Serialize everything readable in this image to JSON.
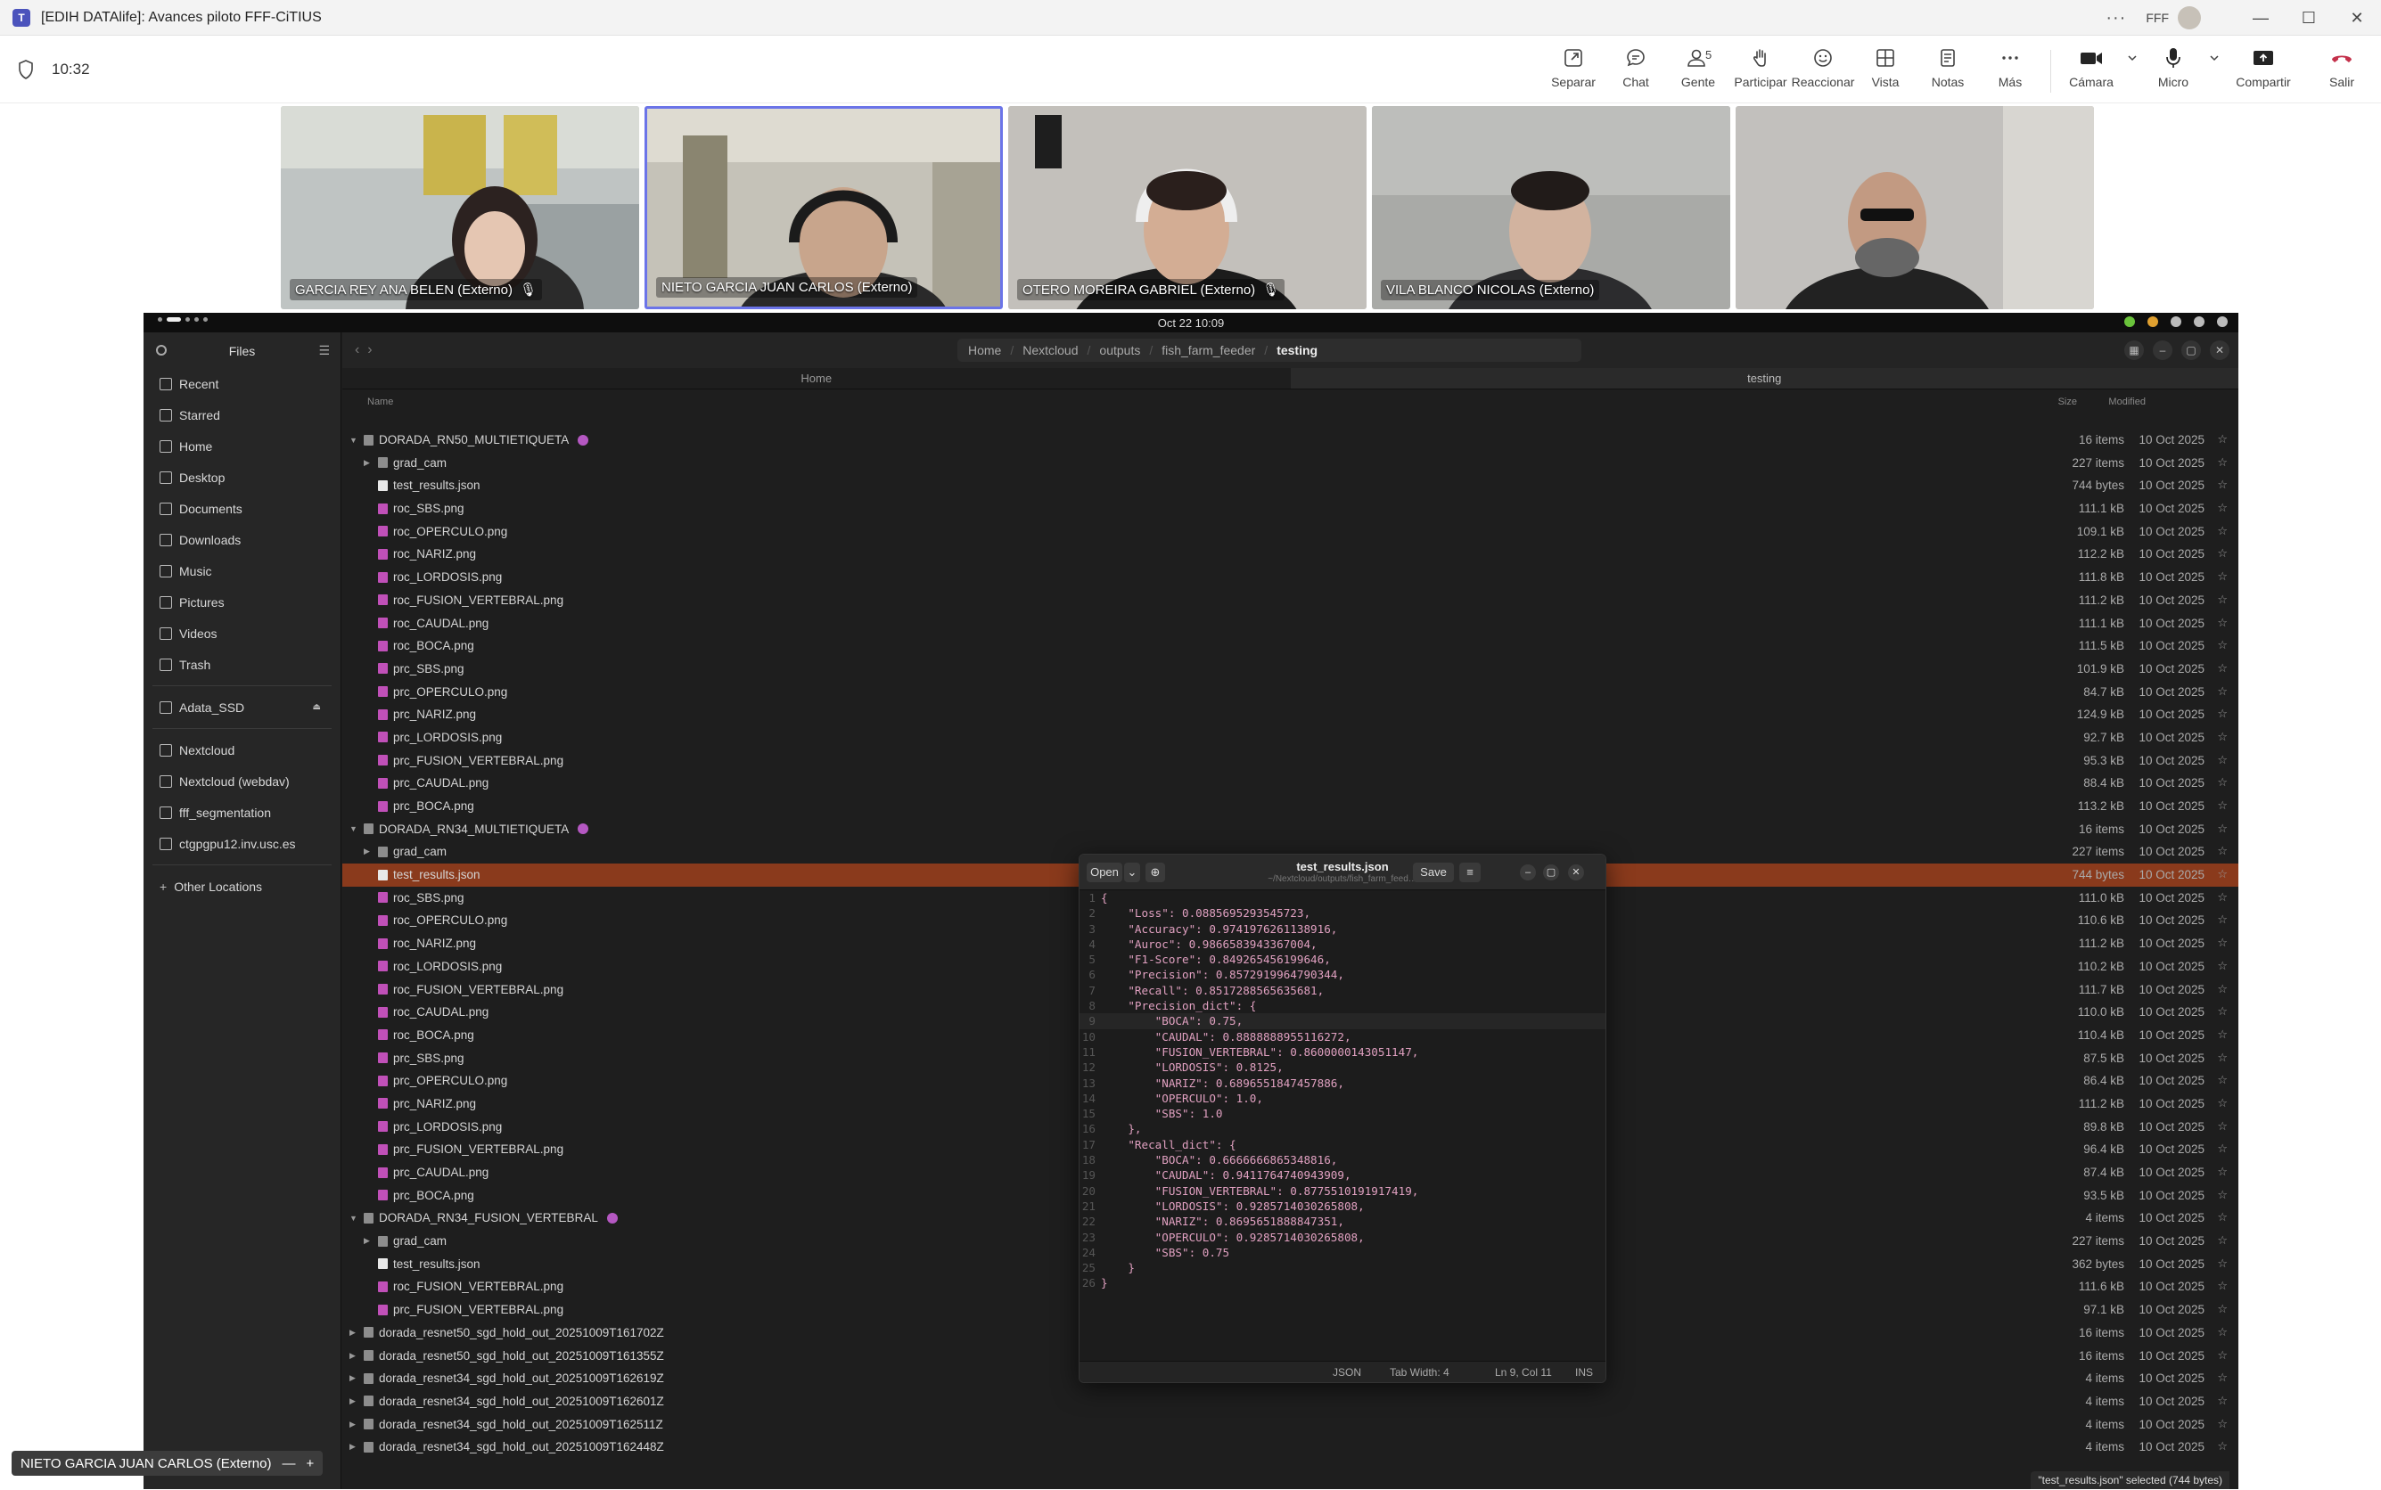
{
  "app": {
    "title": "[EDIH DATAlife]: Avances piloto FFF-CiTIUS",
    "user_initials": "FFF",
    "window_controls": [
      "minimize-icon",
      "maximize-icon",
      "close-icon"
    ]
  },
  "meeting": {
    "timer": "10:32",
    "people_count": "5",
    "tools": [
      {
        "name": "separar",
        "label": "Separar",
        "icon": "popout-icon"
      },
      {
        "name": "chat",
        "label": "Chat",
        "icon": "chat-icon"
      },
      {
        "name": "gente",
        "label": "Gente",
        "icon": "people-icon"
      },
      {
        "name": "participar",
        "label": "Participar",
        "icon": "raise-hand-icon"
      },
      {
        "name": "reaccionar",
        "label": "Reaccionar",
        "icon": "emoji-icon"
      },
      {
        "name": "vista",
        "label": "Vista",
        "icon": "grid-view-icon"
      },
      {
        "name": "notas",
        "label": "Notas",
        "icon": "notes-icon"
      },
      {
        "name": "mas",
        "label": "Más",
        "icon": "more-icon"
      }
    ],
    "device_tools": [
      {
        "name": "camara",
        "label": "Cámara",
        "icon": "camera-icon"
      },
      {
        "name": "micro",
        "label": "Micro",
        "icon": "microphone-icon"
      },
      {
        "name": "compartir",
        "label": "Compartir",
        "icon": "share-screen-icon"
      },
      {
        "name": "salir",
        "label": "Salir",
        "icon": "hangup-icon"
      }
    ],
    "participants": [
      {
        "name": "GARCIA REY ANA BELEN (Externo)",
        "muted": true
      },
      {
        "name": "NIETO GARCIA JUAN CARLOS (Externo)",
        "muted": false,
        "active": true
      },
      {
        "name": "OTERO MOREIRA GABRIEL (Externo)",
        "muted": true
      },
      {
        "name": "VILA BLANCO NICOLAS (Externo)",
        "muted": false
      },
      {
        "name": "",
        "muted": false
      }
    ],
    "presenter_label": "NIETO GARCIA JUAN CARLOS (Externo)",
    "colors": {
      "accent": "#6b74e8",
      "hangup": "#c4314b"
    }
  },
  "desktop": {
    "clock": "Oct 22  10:09"
  },
  "files": {
    "sidebar_title": "Files",
    "places": [
      "Recent",
      "Starred",
      "Home",
      "Desktop",
      "Documents",
      "Downloads",
      "Music",
      "Pictures",
      "Videos",
      "Trash"
    ],
    "devices": [
      "Adata_SSD"
    ],
    "network": [
      "Nextcloud",
      "Nextcloud (webdav)",
      "fff_segmentation",
      "ctgpgpu12.inv.usc.es"
    ],
    "other_locations": "Other Locations",
    "path": [
      "Home",
      "Nextcloud",
      "outputs",
      "fish_farm_feeder",
      "testing"
    ],
    "tabs": [
      "Home",
      "testing"
    ],
    "columns": {
      "name": "Name",
      "size": "Size",
      "modified": "Modified"
    },
    "rows": [
      {
        "name": "DORADA_RN50_MULTIETIQUETA",
        "type": "dir",
        "level": 0,
        "expanded": true,
        "badge": true,
        "size": "16 items",
        "modified": "10 Oct 2025"
      },
      {
        "name": "grad_cam",
        "type": "dir",
        "level": 1,
        "expanded": false,
        "size": "227 items",
        "modified": "10 Oct 2025"
      },
      {
        "name": "test_results.json",
        "type": "json",
        "level": 1,
        "size": "744 bytes",
        "modified": "10 Oct 2025"
      },
      {
        "name": "roc_SBS.png",
        "type": "png",
        "level": 1,
        "size": "111.1 kB",
        "modified": "10 Oct 2025"
      },
      {
        "name": "roc_OPERCULO.png",
        "type": "png",
        "level": 1,
        "size": "109.1 kB",
        "modified": "10 Oct 2025"
      },
      {
        "name": "roc_NARIZ.png",
        "type": "png",
        "level": 1,
        "size": "112.2 kB",
        "modified": "10 Oct 2025"
      },
      {
        "name": "roc_LORDOSIS.png",
        "type": "png",
        "level": 1,
        "size": "111.8 kB",
        "modified": "10 Oct 2025"
      },
      {
        "name": "roc_FUSION_VERTEBRAL.png",
        "type": "png",
        "level": 1,
        "size": "111.2 kB",
        "modified": "10 Oct 2025"
      },
      {
        "name": "roc_CAUDAL.png",
        "type": "png",
        "level": 1,
        "size": "111.1 kB",
        "modified": "10 Oct 2025"
      },
      {
        "name": "roc_BOCA.png",
        "type": "png",
        "level": 1,
        "size": "111.5 kB",
        "modified": "10 Oct 2025"
      },
      {
        "name": "prc_SBS.png",
        "type": "png",
        "level": 1,
        "size": "101.9 kB",
        "modified": "10 Oct 2025"
      },
      {
        "name": "prc_OPERCULO.png",
        "type": "png",
        "level": 1,
        "size": "84.7 kB",
        "modified": "10 Oct 2025"
      },
      {
        "name": "prc_NARIZ.png",
        "type": "png",
        "level": 1,
        "size": "124.9 kB",
        "modified": "10 Oct 2025"
      },
      {
        "name": "prc_LORDOSIS.png",
        "type": "png",
        "level": 1,
        "size": "92.7 kB",
        "modified": "10 Oct 2025"
      },
      {
        "name": "prc_FUSION_VERTEBRAL.png",
        "type": "png",
        "level": 1,
        "size": "95.3 kB",
        "modified": "10 Oct 2025"
      },
      {
        "name": "prc_CAUDAL.png",
        "type": "png",
        "level": 1,
        "size": "88.4 kB",
        "modified": "10 Oct 2025"
      },
      {
        "name": "prc_BOCA.png",
        "type": "png",
        "level": 1,
        "size": "113.2 kB",
        "modified": "10 Oct 2025"
      },
      {
        "name": "DORADA_RN34_MULTIETIQUETA",
        "type": "dir",
        "level": 0,
        "expanded": true,
        "badge": true,
        "size": "16 items",
        "modified": "10 Oct 2025"
      },
      {
        "name": "grad_cam",
        "type": "dir",
        "level": 1,
        "expanded": false,
        "size": "227 items",
        "modified": "10 Oct 2025"
      },
      {
        "name": "test_results.json",
        "type": "json",
        "level": 1,
        "selected": true,
        "size": "744 bytes",
        "modified": "10 Oct 2025"
      },
      {
        "name": "roc_SBS.png",
        "type": "png",
        "level": 1,
        "size": "111.0 kB",
        "modified": "10 Oct 2025"
      },
      {
        "name": "roc_OPERCULO.png",
        "type": "png",
        "level": 1,
        "size": "110.6 kB",
        "modified": "10 Oct 2025"
      },
      {
        "name": "roc_NARIZ.png",
        "type": "png",
        "level": 1,
        "size": "111.2 kB",
        "modified": "10 Oct 2025"
      },
      {
        "name": "roc_LORDOSIS.png",
        "type": "png",
        "level": 1,
        "size": "110.2 kB",
        "modified": "10 Oct 2025"
      },
      {
        "name": "roc_FUSION_VERTEBRAL.png",
        "type": "png",
        "level": 1,
        "size": "111.7 kB",
        "modified": "10 Oct 2025"
      },
      {
        "name": "roc_CAUDAL.png",
        "type": "png",
        "level": 1,
        "size": "110.0 kB",
        "modified": "10 Oct 2025"
      },
      {
        "name": "roc_BOCA.png",
        "type": "png",
        "level": 1,
        "size": "110.4 kB",
        "modified": "10 Oct 2025"
      },
      {
        "name": "prc_SBS.png",
        "type": "png",
        "level": 1,
        "size": "87.5 kB",
        "modified": "10 Oct 2025"
      },
      {
        "name": "prc_OPERCULO.png",
        "type": "png",
        "level": 1,
        "size": "86.4 kB",
        "modified": "10 Oct 2025"
      },
      {
        "name": "prc_NARIZ.png",
        "type": "png",
        "level": 1,
        "size": "111.2 kB",
        "modified": "10 Oct 2025"
      },
      {
        "name": "prc_LORDOSIS.png",
        "type": "png",
        "level": 1,
        "size": "89.8 kB",
        "modified": "10 Oct 2025"
      },
      {
        "name": "prc_FUSION_VERTEBRAL.png",
        "type": "png",
        "level": 1,
        "size": "96.4 kB",
        "modified": "10 Oct 2025"
      },
      {
        "name": "prc_CAUDAL.png",
        "type": "png",
        "level": 1,
        "size": "87.4 kB",
        "modified": "10 Oct 2025"
      },
      {
        "name": "prc_BOCA.png",
        "type": "png",
        "level": 1,
        "size": "93.5 kB",
        "modified": "10 Oct 2025"
      },
      {
        "name": "DORADA_RN34_FUSION_VERTEBRAL",
        "type": "dir",
        "level": 0,
        "expanded": true,
        "badge": true,
        "size": "4 items",
        "modified": "10 Oct 2025"
      },
      {
        "name": "grad_cam",
        "type": "dir",
        "level": 1,
        "expanded": false,
        "size": "227 items",
        "modified": "10 Oct 2025"
      },
      {
        "name": "test_results.json",
        "type": "json",
        "level": 1,
        "size": "362 bytes",
        "modified": "10 Oct 2025"
      },
      {
        "name": "roc_FUSION_VERTEBRAL.png",
        "type": "png",
        "level": 1,
        "size": "111.6 kB",
        "modified": "10 Oct 2025"
      },
      {
        "name": "prc_FUSION_VERTEBRAL.png",
        "type": "png",
        "level": 1,
        "size": "97.1 kB",
        "modified": "10 Oct 2025"
      },
      {
        "name": "dorada_resnet50_sgd_hold_out_20251009T161702Z",
        "type": "dir",
        "level": 0,
        "expanded": false,
        "size": "16 items",
        "modified": "10 Oct 2025"
      },
      {
        "name": "dorada_resnet50_sgd_hold_out_20251009T161355Z",
        "type": "dir",
        "level": 0,
        "expanded": false,
        "size": "16 items",
        "modified": "10 Oct 2025"
      },
      {
        "name": "dorada_resnet34_sgd_hold_out_20251009T162619Z",
        "type": "dir",
        "level": 0,
        "expanded": false,
        "size": "4 items",
        "modified": "10 Oct 2025"
      },
      {
        "name": "dorada_resnet34_sgd_hold_out_20251009T162601Z",
        "type": "dir",
        "level": 0,
        "expanded": false,
        "size": "4 items",
        "modified": "10 Oct 2025"
      },
      {
        "name": "dorada_resnet34_sgd_hold_out_20251009T162511Z",
        "type": "dir",
        "level": 0,
        "expanded": false,
        "size": "4 items",
        "modified": "10 Oct 2025"
      },
      {
        "name": "dorada_resnet34_sgd_hold_out_20251009T162448Z",
        "type": "dir",
        "level": 0,
        "expanded": false,
        "size": "4 items",
        "modified": "10 Oct 2025"
      }
    ],
    "status": "\"test_results.json\" selected (744 bytes)"
  },
  "editor": {
    "title": "test_results.json",
    "subtitle": "~/Nextcloud/outputs/fish_farm_feed…",
    "open_label": "Open",
    "save_label": "Save",
    "language": "JSON",
    "tab_width": "Tab Width: 4",
    "position": "Ln 9, Col 11",
    "mode": "INS",
    "lines": [
      {
        "n": "1",
        "text": "{"
      },
      {
        "n": "2",
        "text": "    \"Loss\": 0.0885695293545723,"
      },
      {
        "n": "3",
        "text": "    \"Accuracy\": 0.9741976261138916,"
      },
      {
        "n": "4",
        "text": "    \"Auroc\": 0.9866583943367004,"
      },
      {
        "n": "5",
        "text": "    \"F1-Score\": 0.849265456199646,"
      },
      {
        "n": "6",
        "text": "    \"Precision\": 0.8572919964790344,"
      },
      {
        "n": "7",
        "text": "    \"Recall\": 0.8517288565635681,"
      },
      {
        "n": "8",
        "text": "    \"Precision_dict\": {"
      },
      {
        "n": "9",
        "text": "        \"BOCA\": 0.75,"
      },
      {
        "n": "10",
        "text": "        \"CAUDAL\": 0.8888888955116272,"
      },
      {
        "n": "11",
        "text": "        \"FUSION_VERTEBRAL\": 0.8600000143051147,"
      },
      {
        "n": "12",
        "text": "        \"LORDOSIS\": 0.8125,"
      },
      {
        "n": "13",
        "text": "        \"NARIZ\": 0.6896551847457886,"
      },
      {
        "n": "14",
        "text": "        \"OPERCULO\": 1.0,"
      },
      {
        "n": "15",
        "text": "        \"SBS\": 1.0"
      },
      {
        "n": "16",
        "text": "    },"
      },
      {
        "n": "17",
        "text": "    \"Recall_dict\": {"
      },
      {
        "n": "18",
        "text": "        \"BOCA\": 0.6666666865348816,"
      },
      {
        "n": "19",
        "text": "        \"CAUDAL\": 0.9411764740943909,"
      },
      {
        "n": "20",
        "text": "        \"FUSION_VERTEBRAL\": 0.8775510191917419,"
      },
      {
        "n": "21",
        "text": "        \"LORDOSIS\": 0.9285714030265808,"
      },
      {
        "n": "22",
        "text": "        \"NARIZ\": 0.8695651888847351,"
      },
      {
        "n": "23",
        "text": "        \"OPERCULO\": 0.9285714030265808,"
      },
      {
        "n": "24",
        "text": "        \"SBS\": 0.75"
      },
      {
        "n": "25",
        "text": "    }"
      },
      {
        "n": "26",
        "text": "}"
      }
    ]
  }
}
